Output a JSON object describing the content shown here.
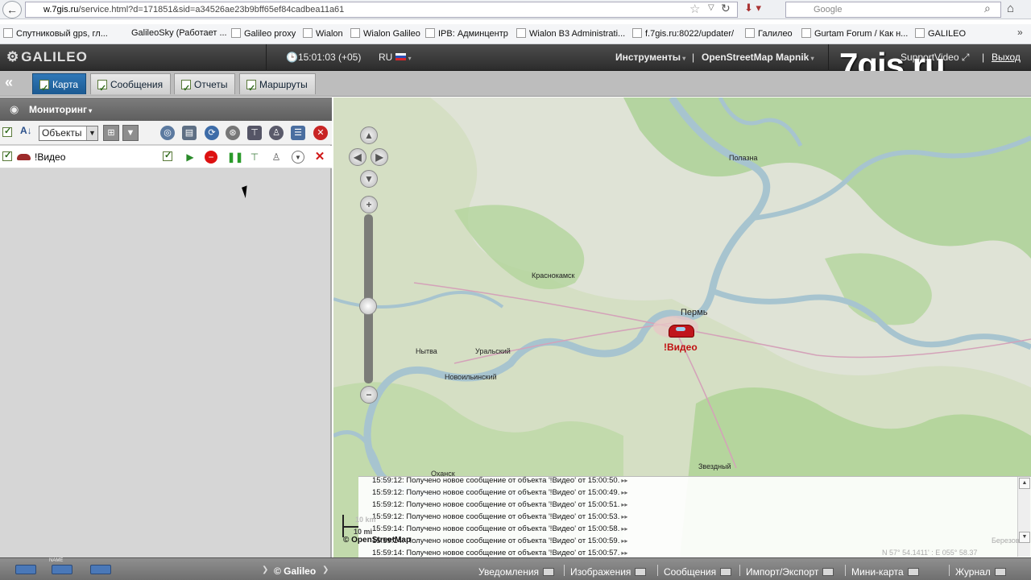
{
  "browser": {
    "url_host": "w.7gis.ru",
    "url_rest": "/service.html?d=171851&sid=a34526ae23b9bff65ef84cadbea11a61",
    "search_placeholder": "Google",
    "bookmarks": [
      "Спутниковый gps, гл...",
      "GalileoSky (Работает ...",
      "Galileo proxy",
      "Wialon",
      "Wialon Galileo",
      "IPB: Админцентр",
      "Wialon B3 Administrati...",
      "f.7gis.ru:8022/updater/",
      "Галилео",
      "Gurtam Forum / Как н...",
      "GALILEO"
    ]
  },
  "header": {
    "logo": "GALILEO",
    "time": "15:01:03 (+05)",
    "lang": "RU",
    "tools": "Инструменты",
    "map_layer": "OpenStreetMap Mapnik",
    "support": "SupportVideo",
    "logout": "Выход",
    "watermark": "7gis.ru"
  },
  "tabs": [
    {
      "label": "Карта",
      "active": true
    },
    {
      "label": "Сообщения",
      "active": false
    },
    {
      "label": "Отчеты",
      "active": false
    },
    {
      "label": "Маршруты",
      "active": false
    }
  ],
  "panel": {
    "title": "Мониторинг",
    "select_value": "Объекты",
    "unit_name": "!Видео"
  },
  "map": {
    "cities": [
      {
        "name": "Полазна"
      },
      {
        "name": "Краснокамск"
      },
      {
        "name": "Пермь"
      },
      {
        "name": "Нытва"
      },
      {
        "name": "Уральский"
      },
      {
        "name": "Новоильинский"
      },
      {
        "name": "Оханск"
      },
      {
        "name": "Звездный"
      }
    ],
    "marker_label": "!Видео",
    "scale_labels": [
      "10 km",
      "10 mi"
    ],
    "attribution": "© OpenStreetMap",
    "coords": "N 57° 54.1411' : E 055° 58.37",
    "corner_label": "Березов"
  },
  "log": [
    "15:59:12: Получено новое сообщение от объекта '!Видео' от 15:00:50.",
    "15:59:12: Получено новое сообщение от объекта '!Видео' от 15:00:49.",
    "15:59:12: Получено новое сообщение от объекта '!Видео' от 15:00:51.",
    "15:59:12: Получено новое сообщение от объекта '!Видео' от 15:00:53.",
    "15:59:14: Получено новое сообщение от объекта '!Видео' от 15:00:58.",
    "15:59:14: Получено новое сообщение от объекта '!Видео' от 15:00:59.",
    "15:59:14: Получено новое сообщение от объекта '!Видео' от 15:00:57."
  ],
  "bottom": {
    "copyright": "© Galileo",
    "items": [
      "Уведомления",
      "Изображения",
      "Сообщения",
      "Импорт/Экспорт",
      "Мини-карта",
      "Журнал"
    ],
    "truck_label": "NAME"
  },
  "colors": {
    "tab_active": "#1c5a92",
    "marker": "#c0161c",
    "header_bg": "#2c2c2c"
  }
}
